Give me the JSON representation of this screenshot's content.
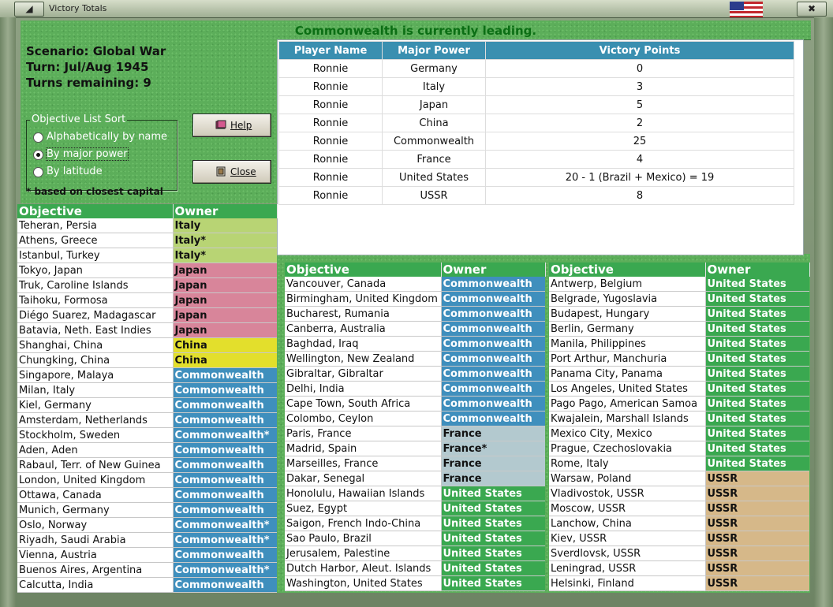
{
  "window": {
    "title": "Victory Totals",
    "close_glyph": "✖",
    "restore_glyph": "◢"
  },
  "banner": "Commonwealth is currently leading.",
  "scenario": "Scenario: Global War",
  "turn": "Turn: Jul/Aug 1945",
  "turns_remaining": "Turns remaining: 9",
  "sort": {
    "legend": "Objective List Sort",
    "options": [
      "Alphabetically by name",
      "By major power",
      "By latitude"
    ],
    "selected_index": 1
  },
  "note": "* based on closest capital",
  "buttons": {
    "help": "Help",
    "close": "Close"
  },
  "vp_table": {
    "headers": [
      "Player Name",
      "Major Power",
      "Victory Points"
    ],
    "rows": [
      [
        "Ronnie",
        "Germany",
        "0"
      ],
      [
        "Ronnie",
        "Italy",
        "3"
      ],
      [
        "Ronnie",
        "Japan",
        "5"
      ],
      [
        "Ronnie",
        "China",
        "2"
      ],
      [
        "Ronnie",
        "Commonwealth",
        "25"
      ],
      [
        "Ronnie",
        "France",
        "4"
      ],
      [
        "Ronnie",
        "United States",
        "20 - 1 (Brazil + Mexico) = 19"
      ],
      [
        "Ronnie",
        "USSR",
        "8"
      ]
    ]
  },
  "owner_colors": {
    "Italy": "#b8d474",
    "Japan": "#d8859a",
    "China": "#e3df2c",
    "Commonwealth": "#3f8fbd",
    "France": "#b3c9cf",
    "United States": "#3aa850",
    "USSR": "#d6b889"
  },
  "objectives_headers": {
    "objective": "Objective",
    "owner": "Owner"
  },
  "objectives": {
    "col1": [
      [
        "Teheran, Persia",
        "Italy"
      ],
      [
        "Athens, Greece",
        "Italy*"
      ],
      [
        "Istanbul, Turkey",
        "Italy*"
      ],
      [
        "Tokyo, Japan",
        "Japan"
      ],
      [
        "Truk, Caroline Islands",
        "Japan"
      ],
      [
        "Taihoku, Formosa",
        "Japan"
      ],
      [
        "Diégo Suarez, Madagascar",
        "Japan"
      ],
      [
        "Batavia, Neth. East Indies",
        "Japan"
      ],
      [
        "Shanghai, China",
        "China"
      ],
      [
        "Chungking, China",
        "China"
      ],
      [
        "Singapore, Malaya",
        "Commonwealth"
      ],
      [
        "Milan, Italy",
        "Commonwealth"
      ],
      [
        "Kiel, Germany",
        "Commonwealth"
      ],
      [
        "Amsterdam, Netherlands",
        "Commonwealth"
      ],
      [
        "Stockholm, Sweden",
        "Commonwealth*"
      ],
      [
        "Aden, Aden",
        "Commonwealth"
      ],
      [
        "Rabaul, Terr. of New Guinea",
        "Commonwealth"
      ],
      [
        "London, United Kingdom",
        "Commonwealth"
      ],
      [
        "Ottawa, Canada",
        "Commonwealth"
      ],
      [
        "Munich, Germany",
        "Commonwealth"
      ],
      [
        "Oslo, Norway",
        "Commonwealth*"
      ],
      [
        "Riyadh, Saudi Arabia",
        "Commonwealth*"
      ],
      [
        "Vienna, Austria",
        "Commonwealth"
      ],
      [
        "Buenos Aires, Argentina",
        "Commonwealth*"
      ],
      [
        "Calcutta, India",
        "Commonwealth"
      ]
    ],
    "col2": [
      [
        "Vancouver, Canada",
        "Commonwealth"
      ],
      [
        "Birmingham, United Kingdom",
        "Commonwealth"
      ],
      [
        "Bucharest, Rumania",
        "Commonwealth"
      ],
      [
        "Canberra, Australia",
        "Commonwealth"
      ],
      [
        "Baghdad, Iraq",
        "Commonwealth"
      ],
      [
        "Wellington, New Zealand",
        "Commonwealth"
      ],
      [
        "Gibraltar, Gibraltar",
        "Commonwealth"
      ],
      [
        "Delhi, India",
        "Commonwealth"
      ],
      [
        "Cape Town, South Africa",
        "Commonwealth"
      ],
      [
        "Colombo, Ceylon",
        "Commonwealth"
      ],
      [
        "Paris, France",
        "France"
      ],
      [
        "Madrid, Spain",
        "France*"
      ],
      [
        "Marseilles, France",
        "France"
      ],
      [
        "Dakar, Senegal",
        "France"
      ],
      [
        "Honolulu, Hawaiian Islands",
        "United States"
      ],
      [
        "Suez, Egypt",
        "United States"
      ],
      [
        "Saigon, French Indo-China",
        "United States"
      ],
      [
        "Sao Paulo, Brazil",
        "United States"
      ],
      [
        "Jerusalem, Palestine",
        "United States"
      ],
      [
        "Dutch Harbor, Aleut. Islands",
        "United States"
      ],
      [
        "Washington, United States",
        "United States"
      ]
    ],
    "col3": [
      [
        "Antwerp, Belgium",
        "United States"
      ],
      [
        "Belgrade, Yugoslavia",
        "United States"
      ],
      [
        "Budapest, Hungary",
        "United States"
      ],
      [
        "Berlin, Germany",
        "United States"
      ],
      [
        "Manila, Philippines",
        "United States"
      ],
      [
        "Port Arthur, Manchuria",
        "United States"
      ],
      [
        "Panama City, Panama",
        "United States"
      ],
      [
        "Los Angeles, United States",
        "United States"
      ],
      [
        "Pago Pago, American Samoa",
        "United States"
      ],
      [
        "Kwajalein, Marshall Islands",
        "United States"
      ],
      [
        "Mexico City, Mexico",
        "United States"
      ],
      [
        "Prague, Czechoslovakia",
        "United States"
      ],
      [
        "Rome, Italy",
        "United States"
      ],
      [
        "Warsaw, Poland",
        "USSR"
      ],
      [
        "Vladivostok, USSR",
        "USSR"
      ],
      [
        "Moscow, USSR",
        "USSR"
      ],
      [
        "Lanchow, China",
        "USSR"
      ],
      [
        "Kiev, USSR",
        "USSR"
      ],
      [
        "Sverdlovsk, USSR",
        "USSR"
      ],
      [
        "Leningrad, USSR",
        "USSR"
      ],
      [
        "Helsinki, Finland",
        "USSR"
      ]
    ]
  }
}
